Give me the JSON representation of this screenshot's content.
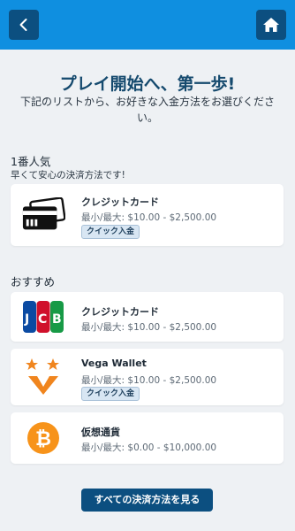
{
  "header": {
    "back_icon": "chevron-left-icon",
    "home_icon": "home-icon",
    "bar_color": "#0f8fe0",
    "button_color": "#0c4f80"
  },
  "intro": {
    "title": "プレイ開始へ、第一歩!",
    "subtitle": "下記のリストから、お好きな入金方法をお選びください。"
  },
  "popular": {
    "label": "1番人気",
    "sublabel": "早くて安心の決済方法です!",
    "item": {
      "name": "クレジットカード",
      "limit": "最小/最大: $10.00 - $2,500.00",
      "badge": "クイック入金",
      "icon": "credit-card-icon"
    }
  },
  "recommended": {
    "label": "おすすめ",
    "items": [
      {
        "name": "クレジットカード",
        "limit": "最小/最大: $10.00 - $2,500.00",
        "icon": "jcb-logo-icon"
      },
      {
        "name": "Vega Wallet",
        "limit": "最小/最大: $10.00 - $2,500.00",
        "badge": "クイック入金",
        "icon": "vega-wallet-icon"
      },
      {
        "name": "仮想通貨",
        "limit": "最小/最大: $0.00 - $10,000.00",
        "icon": "bitcoin-icon"
      }
    ]
  },
  "footer": {
    "cta_label": "すべての決済方法を見る"
  }
}
